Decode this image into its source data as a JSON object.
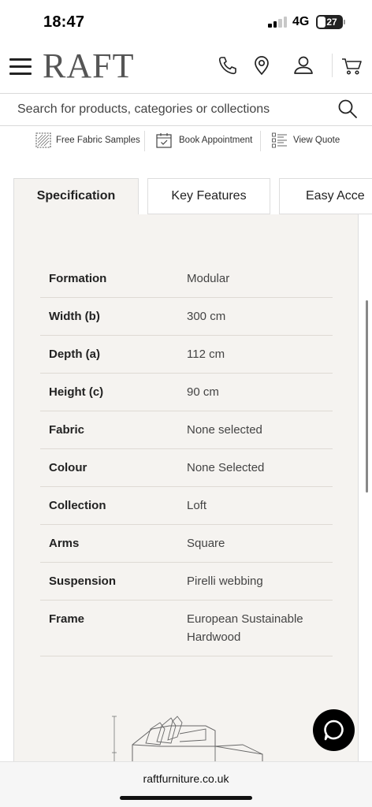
{
  "status_bar": {
    "time": "18:47",
    "network": "4G",
    "battery": "27"
  },
  "header": {
    "logo": "RAFT",
    "icons": [
      "menu-icon",
      "phone-icon",
      "location-pin-icon",
      "user-icon",
      "cart-icon"
    ]
  },
  "search": {
    "placeholder": "Search for products, categories or collections"
  },
  "quick_links": [
    {
      "label": "Free Fabric Samples",
      "icon": "fabric-swatch-icon"
    },
    {
      "label": "Book Appointment",
      "icon": "calendar-check-icon"
    },
    {
      "label": "View Quote",
      "icon": "checklist-icon"
    }
  ],
  "tabs": [
    {
      "label": "Specification",
      "active": true
    },
    {
      "label": "Key Features",
      "active": false
    },
    {
      "label": "Easy Acce",
      "active": false
    }
  ],
  "specification": [
    {
      "label": "Formation",
      "value": "Modular"
    },
    {
      "label": "Width (b)",
      "value": "300 cm"
    },
    {
      "label": "Depth (a)",
      "value": "112 cm"
    },
    {
      "label": "Height (c)",
      "value": "90 cm"
    },
    {
      "label": "Fabric",
      "value": "None selected"
    },
    {
      "label": "Colour",
      "value": "None Selected"
    },
    {
      "label": "Collection",
      "value": "Loft"
    },
    {
      "label": "Arms",
      "value": "Square"
    },
    {
      "label": "Suspension",
      "value": "Pirelli webbing"
    },
    {
      "label": "Frame",
      "value": "European Sustainable Hardwood"
    }
  ],
  "footer": {
    "url": "raftfurniture.co.uk"
  },
  "colors": {
    "panel_bg": "#f5f3f0",
    "border": "#dddddd",
    "text": "#222222",
    "chat_button": "#000000"
  }
}
